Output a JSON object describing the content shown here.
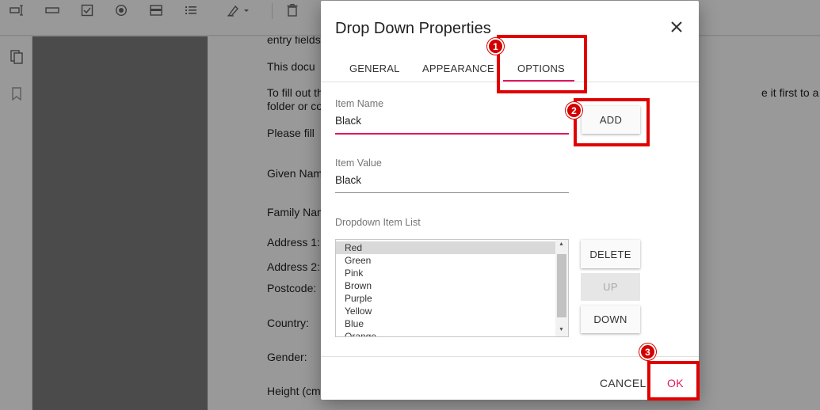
{
  "toolbar": {
    "icons": [
      "text-field-icon",
      "textbox-icon",
      "checkbox-icon",
      "radio-button-icon",
      "dropdown-field-icon",
      "list-field-icon",
      "signature-pen-icon",
      "delete-trash-icon"
    ]
  },
  "sidebar": {
    "icons": [
      "page-thumbnails-icon",
      "bookmark-icon"
    ]
  },
  "document": {
    "lines": [
      "entry fields",
      "This docu",
      "To fill out th",
      "folder or co",
      "Please fill",
      "Given Nam",
      "Family Nam",
      "Address 1:",
      "Address 2:",
      "Postcode:",
      "Country:",
      "Gender:",
      "Height (cm"
    ],
    "right_fragment": "e it first to a"
  },
  "dialog": {
    "title": "Drop Down Properties",
    "tabs": [
      {
        "label": "GENERAL"
      },
      {
        "label": "APPEARANCE"
      },
      {
        "label": "OPTIONS",
        "active": true
      }
    ],
    "item_name": {
      "label": "Item Name",
      "value": "Black"
    },
    "add_label": "ADD",
    "item_value": {
      "label": "Item Value",
      "value": "Black"
    },
    "list_label": "Dropdown Item List",
    "items": [
      "Red",
      "Green",
      "Pink",
      "Brown",
      "Purple",
      "Yellow",
      "Blue",
      "Orange"
    ],
    "selected_item": "Red",
    "delete_label": "DELETE",
    "up_label": "UP",
    "down_label": "DOWN",
    "cancel_label": "CANCEL",
    "ok_label": "OK"
  },
  "annotations": {
    "badges": [
      "1",
      "2",
      "3"
    ],
    "highlight_color": "#e00000"
  },
  "colors": {
    "accent": "#e3165b",
    "overlay": "rgba(0,0,0,0.40)"
  }
}
